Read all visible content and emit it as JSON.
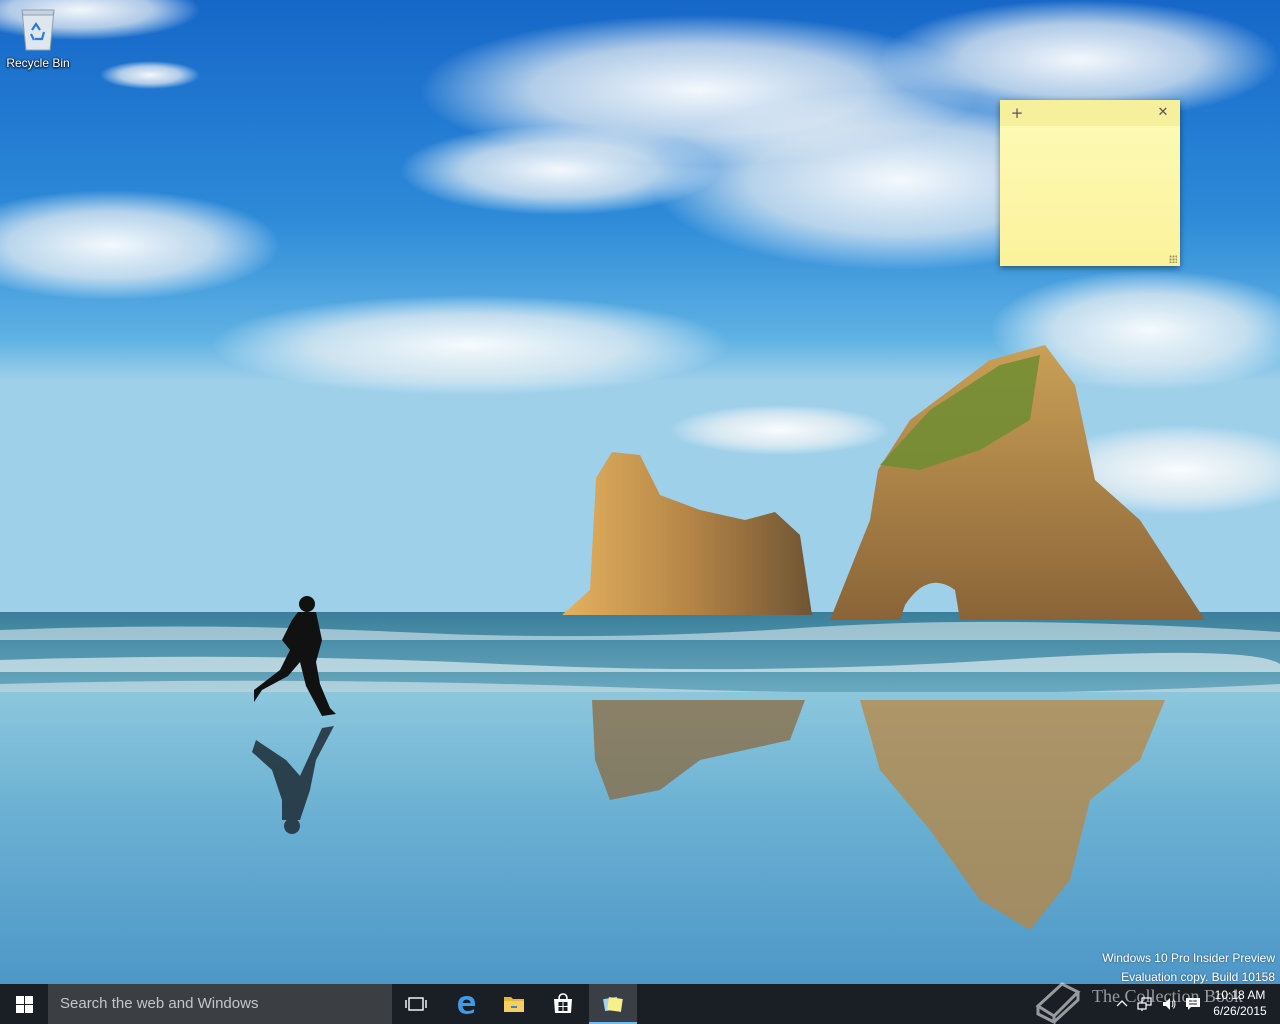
{
  "desktop": {
    "icons": [
      {
        "label": "Recycle Bin",
        "icon": "recycle-bin-icon"
      }
    ]
  },
  "sticky_note": {
    "add_glyph": "+",
    "close_glyph": "✕",
    "text": "",
    "color": "#fcf6a5"
  },
  "watermark": {
    "line1": "Windows 10 Pro Insider Preview",
    "line2": "Evaluation copy. Build 10158"
  },
  "taskbar": {
    "start_icon": "windows-logo-icon",
    "search_placeholder": "Search the web and Windows",
    "pinned": [
      {
        "name": "task-view",
        "icon": "task-view-icon"
      },
      {
        "name": "edge",
        "icon": "edge-icon"
      },
      {
        "name": "file-explorer",
        "icon": "folder-icon"
      },
      {
        "name": "store",
        "icon": "store-icon"
      },
      {
        "name": "sticky-notes",
        "icon": "sticky-notes-icon",
        "active": true
      }
    ],
    "tray": {
      "icons": [
        "chevron-up-icon",
        "network-icon",
        "volume-icon",
        "action-center-icon"
      ],
      "time": "10:18 AM",
      "date": "6/26/2015"
    },
    "accent_color": "#76b9ed"
  },
  "overlay_logo": {
    "text": "The Collection Book"
  }
}
